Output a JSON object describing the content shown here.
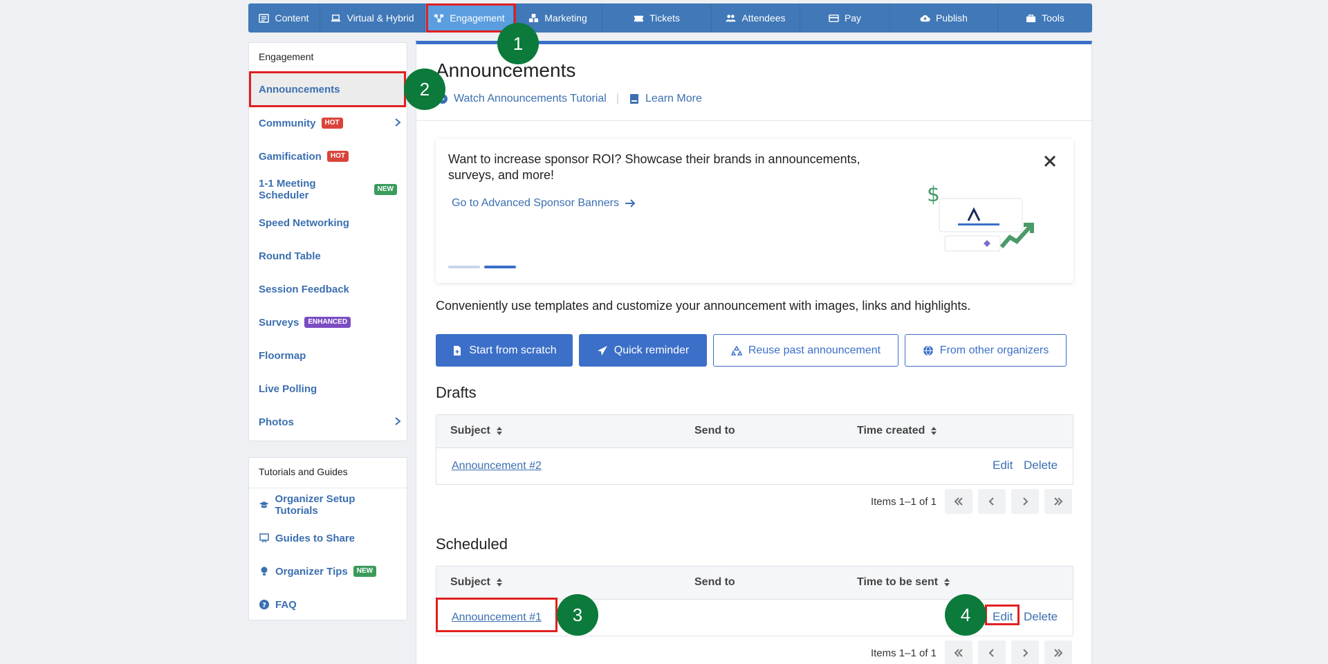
{
  "nav": {
    "items": [
      {
        "label": "Content",
        "icon": "list-icon"
      },
      {
        "label": "Virtual & Hybrid",
        "icon": "laptop-icon"
      },
      {
        "label": "Engagement",
        "icon": "network-icon"
      },
      {
        "label": "Marketing",
        "icon": "cubes-icon"
      },
      {
        "label": "Tickets",
        "icon": "ticket-icon"
      },
      {
        "label": "Attendees",
        "icon": "users-icon"
      },
      {
        "label": "Pay",
        "icon": "card-icon"
      },
      {
        "label": "Publish",
        "icon": "cloud-upload-icon"
      },
      {
        "label": "Tools",
        "icon": "toolbox-icon"
      }
    ]
  },
  "sidebar": {
    "heading": "Engagement",
    "items": [
      {
        "label": "Announcements"
      },
      {
        "label": "Community",
        "badge": "HOT"
      },
      {
        "label": "Gamification",
        "badge": "HOT"
      },
      {
        "label": "1-1 Meeting Scheduler",
        "badge": "NEW"
      },
      {
        "label": "Speed Networking"
      },
      {
        "label": "Round Table"
      },
      {
        "label": "Session Feedback"
      },
      {
        "label": "Surveys",
        "badge": "ENHANCED"
      },
      {
        "label": "Floormap"
      },
      {
        "label": "Live Polling"
      },
      {
        "label": "Photos"
      }
    ],
    "tutorials_heading": "Tutorials and Guides",
    "tutorials": [
      {
        "label": "Organizer Setup Tutorials",
        "icon": "graduation-cap-icon"
      },
      {
        "label": "Guides to Share",
        "icon": "presentation-icon"
      },
      {
        "label": "Organizer Tips",
        "icon": "lightbulb-icon",
        "badge": "NEW"
      },
      {
        "label": "FAQ",
        "icon": "question-circle-icon"
      }
    ]
  },
  "main": {
    "title": "Announcements",
    "watch_link": "Watch Announcements Tutorial",
    "sep": "|",
    "learn_link": "Learn More",
    "promo": {
      "text": "Want to increase sponsor ROI? Showcase their brands in announcements, surveys, and more!",
      "link": "Go to Advanced Sponsor Banners"
    },
    "description": "Conveniently use templates and customize your announcement with images, links and highlights.",
    "buttons": {
      "scratch": "Start from scratch",
      "reminder": "Quick reminder",
      "reuse": "Reuse past announcement",
      "others": "From other organizers"
    },
    "drafts": {
      "heading": "Drafts",
      "col_subject": "Subject",
      "col_send": "Send to",
      "col_time": "Time created",
      "rows": [
        {
          "subject": "Announcement #2",
          "edit": "Edit",
          "delete": "Delete"
        }
      ],
      "pager": "Items 1–1 of 1"
    },
    "scheduled": {
      "heading": "Scheduled",
      "col_subject": "Subject",
      "col_send": "Send to",
      "col_time": "Time to be sent",
      "rows": [
        {
          "subject": "Announcement #1",
          "edit": "Edit",
          "delete": "Delete"
        }
      ],
      "pager": "Items 1–1 of 1"
    }
  },
  "markers": [
    "1",
    "2",
    "3",
    "4"
  ],
  "colors": {
    "nav_bg": "#4078b8",
    "nav_active": "#5a9ee0",
    "accent": "#3b6fc8",
    "marker": "#0b7a3a",
    "highlight": "#e02020"
  }
}
